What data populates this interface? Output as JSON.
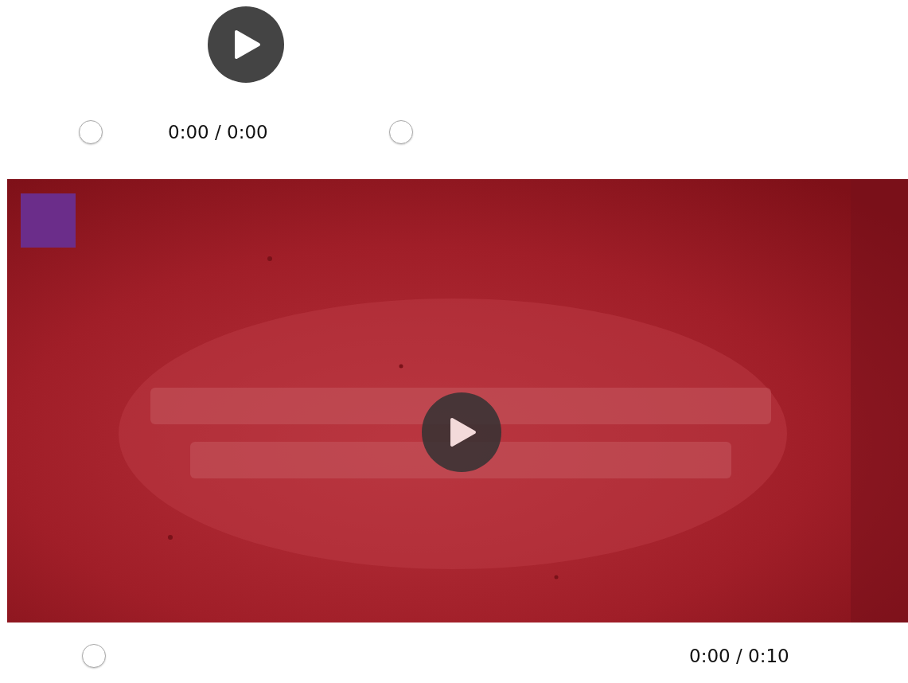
{
  "players": [
    {
      "kind": "bare",
      "time": "0:00 / 0:00"
    },
    {
      "kind": "video",
      "time": "0:00 / 0:10"
    }
  ]
}
